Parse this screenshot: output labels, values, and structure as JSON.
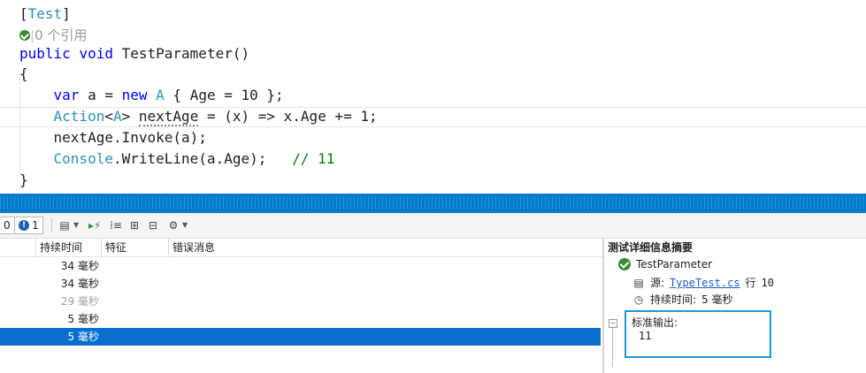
{
  "editor": {
    "attribute": {
      "open": "[",
      "name": "Test",
      "close": "]"
    },
    "codelens": "0 个引用",
    "method": {
      "kw_public": "public",
      "kw_void": "void",
      "name": "TestParameter",
      "parens": "()"
    },
    "open_brace": "{",
    "close_brace": "}",
    "line_var": {
      "kw_var": "var",
      "p1": " a = ",
      "kw_new": "new",
      "type_a": "A",
      "p2": " { Age = 10 };"
    },
    "line_action": {
      "type_action": "Action",
      "lt": "<",
      "type_a": "A",
      "gt": ">",
      "sp": " ",
      "name": "nextAge",
      "rest": " = (x) => x.Age += 1;"
    },
    "line_invoke": "nextAge.Invoke(a);",
    "line_console": {
      "type_console": "Console",
      "method": ".WriteLine(a.Age);",
      "spacing": "   ",
      "comment": "// 11"
    }
  },
  "toolbar": {
    "count_left": "0",
    "error_count": "1",
    "error_badge": "!"
  },
  "grid": {
    "columns": [
      "持续时间",
      "特征",
      "错误消息"
    ],
    "rows": [
      {
        "duration": "34 毫秒",
        "state": "normal"
      },
      {
        "duration": "34 毫秒",
        "state": "normal"
      },
      {
        "duration": "29 毫秒",
        "state": "dim"
      },
      {
        "duration": "5 毫秒",
        "state": "normal"
      },
      {
        "duration": "5 毫秒",
        "state": "selected"
      }
    ]
  },
  "details": {
    "title": "测试详细信息摘要",
    "test_name": "TestParameter",
    "source_label": "源:",
    "source_file": "TypeTest.cs",
    "source_line_label": "行",
    "source_line": "10",
    "duration_label": "持续时间:",
    "duration_value": "5 毫秒",
    "stdout_label": "标准输出:",
    "stdout_value": "11"
  },
  "colors": {
    "accent": "#007acc",
    "selection": "#0a6ed1",
    "pass": "#388a34",
    "keyword": "#0000ff",
    "type": "#2b91af",
    "comment": "#008000",
    "output_border": "#1e98d8"
  },
  "icons": [
    "check-icon",
    "error-icon",
    "playlist-icon",
    "run-icon",
    "group-by-icon",
    "expand-all-icon",
    "collapse-all-icon",
    "settings-icon",
    "source-file-icon",
    "clock-icon"
  ]
}
